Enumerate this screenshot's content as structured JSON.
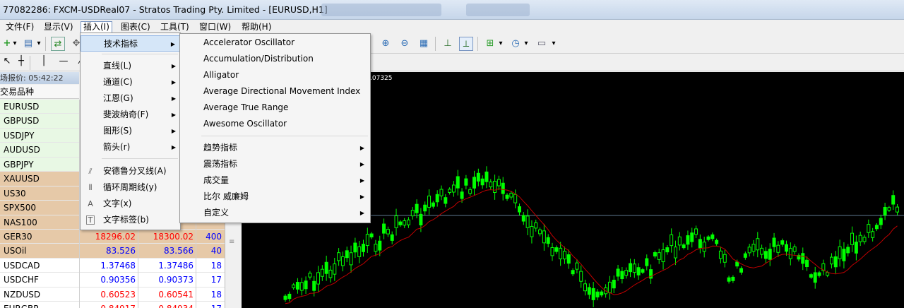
{
  "window": {
    "title": "77082286: FXCM-USDReal07 - Stratos Trading Pty. Limited - [EURUSD,H1]"
  },
  "menubar": {
    "items": [
      "文件(F)",
      "显示(V)",
      "插入(I)",
      "图表(C)",
      "工具(T)",
      "窗口(W)",
      "帮助(H)"
    ]
  },
  "market_watch": {
    "header": "场报价: 05:42:22",
    "column_symbol": "交易品种",
    "rows": [
      {
        "symbol": "EURUSD",
        "bid": "",
        "ask": "",
        "spread": "",
        "bg": "green",
        "color": "#0000ff"
      },
      {
        "symbol": "GBPUSD",
        "bid": "",
        "ask": "",
        "spread": "",
        "bg": "green",
        "color": "#0000ff"
      },
      {
        "symbol": "USDJPY",
        "bid": "",
        "ask": "",
        "spread": "",
        "bg": "green",
        "color": "#0000ff"
      },
      {
        "symbol": "AUDUSD",
        "bid": "",
        "ask": "",
        "spread": "",
        "bg": "green",
        "color": "#0000ff"
      },
      {
        "symbol": "GBPJPY",
        "bid": "",
        "ask": "",
        "spread": "",
        "bg": "green",
        "color": "#0000ff"
      },
      {
        "symbol": "XAUUSD",
        "bid": "",
        "ask": "",
        "spread": "",
        "bg": "tan",
        "color": "#0000ff"
      },
      {
        "symbol": "US30",
        "bid": "",
        "ask": "",
        "spread": "",
        "bg": "tan",
        "color": "#0000ff"
      },
      {
        "symbol": "SPX500",
        "bid": "",
        "ask": "",
        "spread": "",
        "bg": "tan",
        "color": "#0000ff"
      },
      {
        "symbol": "NAS100",
        "bid": "",
        "ask": "",
        "spread": "",
        "bg": "tan",
        "color": "#0000ff"
      },
      {
        "symbol": "GER30",
        "bid": "18296.02",
        "ask": "18300.02",
        "spread": "400",
        "bg": "tan",
        "color": "#ff0000"
      },
      {
        "symbol": "USOil",
        "bid": "83.526",
        "ask": "83.566",
        "spread": "40",
        "bg": "tan",
        "color": "#0000ff"
      },
      {
        "symbol": "USDCAD",
        "bid": "1.37468",
        "ask": "1.37486",
        "spread": "18",
        "bg": "white",
        "color": "#0000ff"
      },
      {
        "symbol": "USDCHF",
        "bid": "0.90356",
        "ask": "0.90373",
        "spread": "17",
        "bg": "white",
        "color": "#0000ff"
      },
      {
        "symbol": "NZDUSD",
        "bid": "0.60523",
        "ask": "0.60541",
        "spread": "18",
        "bg": "white",
        "color": "#ff0000"
      },
      {
        "symbol": "EURGBP",
        "bid": "0.84917",
        "ask": "0.84934",
        "spread": "17",
        "bg": "white",
        "color": "#ff0000"
      }
    ]
  },
  "chart": {
    "label": ".07325"
  },
  "insert_menu": {
    "items": [
      {
        "label": "技术指标",
        "submenu": true,
        "highlighted": true,
        "icon": ""
      },
      {
        "label": "直线(L)",
        "submenu": true,
        "icon": ""
      },
      {
        "label": "通道(C)",
        "submenu": true,
        "icon": ""
      },
      {
        "label": "江恩(G)",
        "submenu": true,
        "icon": ""
      },
      {
        "label": "斐波纳奇(F)",
        "submenu": true,
        "icon": ""
      },
      {
        "label": "图形(S)",
        "submenu": true,
        "icon": ""
      },
      {
        "label": "箭头(r)",
        "submenu": true,
        "icon": ""
      },
      {
        "label": "安德鲁分叉线(A)",
        "submenu": false,
        "icon": "andrews-pitchfork-icon"
      },
      {
        "label": "循环周期线(y)",
        "submenu": false,
        "icon": "cycle-lines-icon"
      },
      {
        "label": "文字(x)",
        "submenu": false,
        "icon": "text-icon"
      },
      {
        "label": "文字标签(b)",
        "submenu": false,
        "icon": "text-label-icon"
      }
    ]
  },
  "indicators_submenu": {
    "items": [
      {
        "label": "Accelerator Oscillator",
        "submenu": false
      },
      {
        "label": "Accumulation/Distribution",
        "submenu": false
      },
      {
        "label": "Alligator",
        "submenu": false
      },
      {
        "label": "Average Directional Movement Index",
        "submenu": false
      },
      {
        "label": "Average True Range",
        "submenu": false
      },
      {
        "label": "Awesome Oscillator",
        "submenu": false
      },
      {
        "label": "趋势指标",
        "submenu": true
      },
      {
        "label": "震荡指标",
        "submenu": true
      },
      {
        "label": "成交量",
        "submenu": true
      },
      {
        "label": "比尔 威廉姆",
        "submenu": true
      },
      {
        "label": "自定义",
        "submenu": true
      }
    ]
  },
  "colors": {
    "candle": "#00ff00",
    "ma_line": "#c00000",
    "price_line": "#5e7890"
  }
}
